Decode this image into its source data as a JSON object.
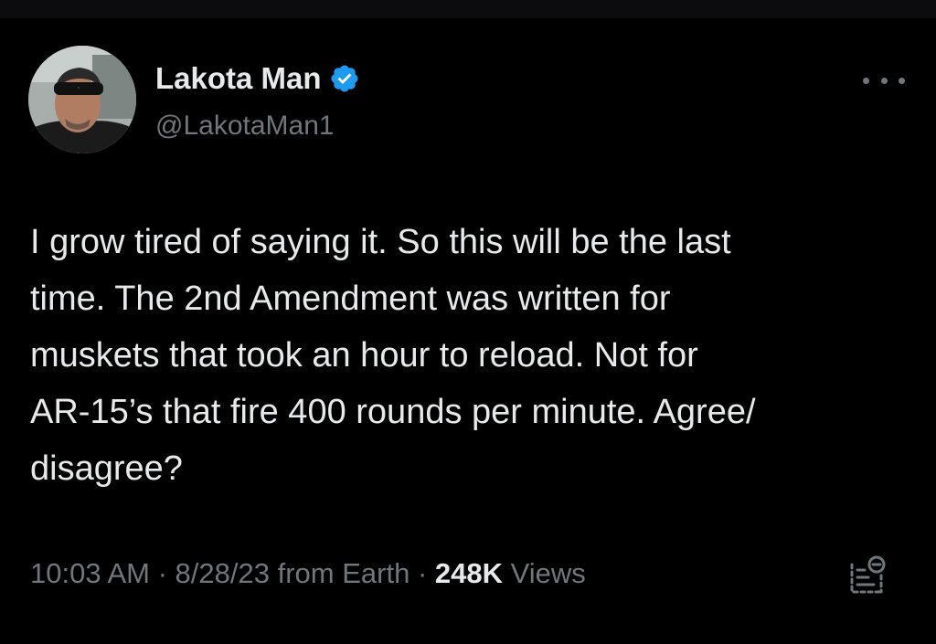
{
  "tweet": {
    "author": {
      "display_name": "Lakota Man",
      "handle": "@LakotaMan1",
      "verified": true,
      "avatar": "profile-photo"
    },
    "text": "I grow tired of saying it. So this will be the last time. The 2nd Amendment was written for muskets that took an hour to reload. Not for AR-15’s that fire 400 rounds per minute. Agree/ disagree?",
    "text_lines": [
      "I grow tired of saying it. So this will be the last",
      "time. The 2nd Amendment was written for",
      "muskets that took an hour to reload. Not for",
      "AR-15’s that fire 400 rounds per minute. Agree/",
      "disagree?"
    ],
    "time": "10:03 AM",
    "separator": " · ",
    "date": "8/28/23",
    "source": "from Earth",
    "views_count": "248K",
    "views_label": "Views"
  },
  "icons": {
    "verified": "verified-badge-icon",
    "more": "more-options-icon",
    "analytics": "analytics-icon"
  },
  "colors": {
    "background": "#000000",
    "primary_text": "#e7e9ea",
    "secondary_text": "#71767b",
    "verified_blue": "#1d9bf0"
  }
}
